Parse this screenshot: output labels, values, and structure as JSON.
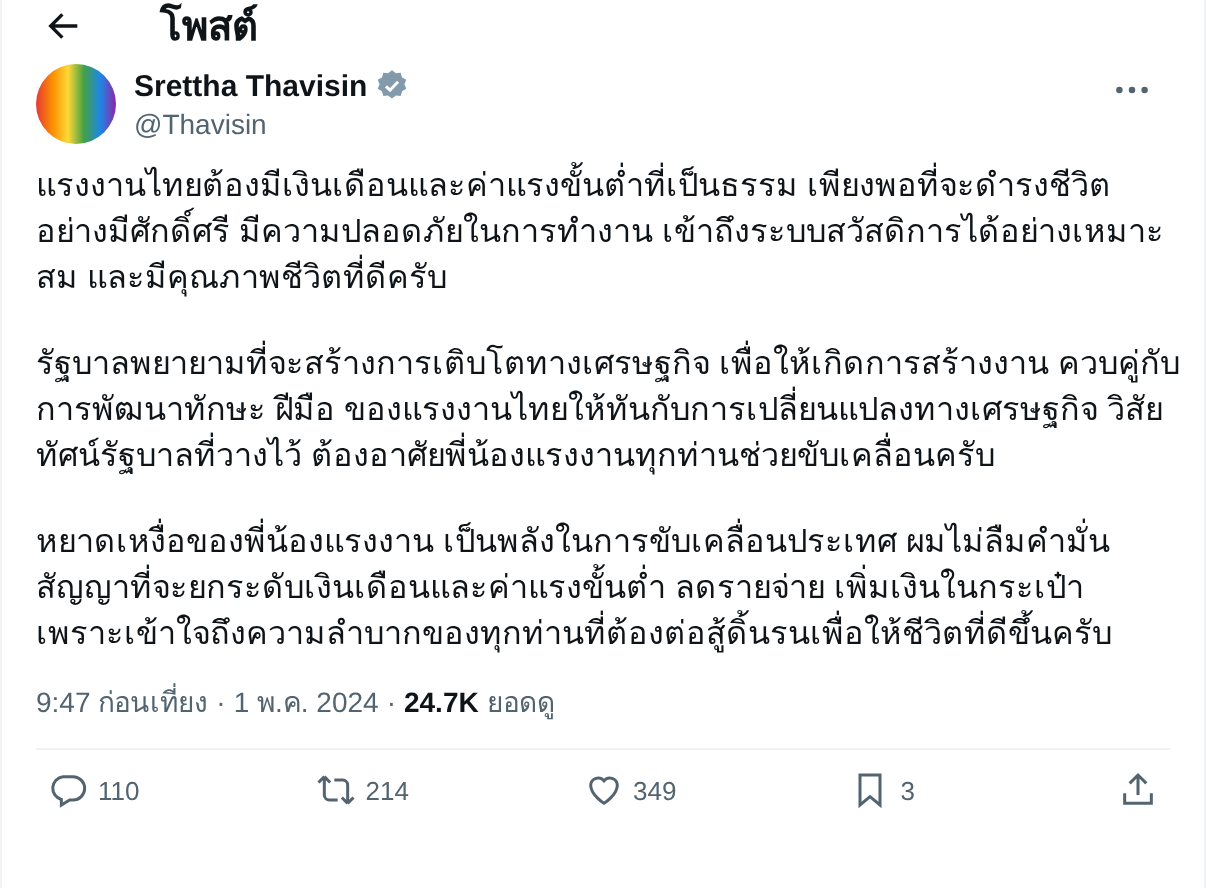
{
  "header": {
    "title": "โพสต์"
  },
  "author": {
    "name": "Srettha Thavisin",
    "verified": true,
    "handle": "@Thavisin"
  },
  "paragraphs": [
    "แรงงานไทยต้องมีเงินเดือนและค่าแรงขั้นต่ำที่เป็นธรรม เพียงพอที่จะดำรงชีวิตอย่างมีศักดิ์ศรี มีความปลอดภัยในการทำงาน เข้าถึงระบบสวัสดิการได้อย่างเหมาะสม และมีคุณภาพชีวิตที่ดีครับ",
    "รัฐบาลพยายามที่จะสร้างการเติบโตทางเศรษฐกิจ เพื่อให้เกิดการสร้างงาน ควบคู่กับการพัฒนาทักษะ ฝีมือ ของแรงงานไทยให้ทันกับการเปลี่ยนแปลงทางเศรษฐกิจ วิสัยทัศน์รัฐบาลที่วางไว้ ต้องอาศัยพี่น้องแรงงานทุกท่านช่วยขับเคลื่อนครับ",
    "หยาดเหงื่อของพี่น้องแรงงาน เป็นพลังในการขับเคลื่อนประเทศ ผมไม่ลืมคำมั่นสัญญาที่จะยกระดับเงินเดือนและค่าแรงขั้นต่ำ ลดรายจ่าย เพิ่มเงินในกระเป๋า เพราะเข้าใจถึงความลำบากของทุกท่านที่ต้องต่อสู้ดิ้นรนเพื่อให้ชีวิตที่ดีขึ้นครับ"
  ],
  "meta": {
    "separator": "·",
    "time": "9:47 ก่อนเที่ยง",
    "date": "1 พ.ค. 2024",
    "views": "24.7K",
    "views_label": "ยอดดู"
  },
  "actions": [
    {
      "kind": "reply",
      "count": "110"
    },
    {
      "kind": "repost",
      "count": "214"
    },
    {
      "kind": "like",
      "count": "349"
    },
    {
      "kind": "bookmark",
      "count": "3"
    },
    {
      "kind": "share"
    }
  ]
}
